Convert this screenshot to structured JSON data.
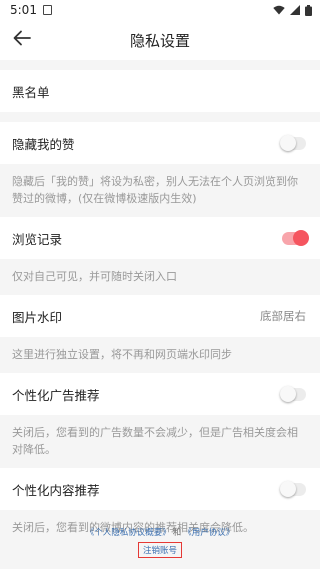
{
  "status_bar": {
    "time": "5:01",
    "icons": [
      "sim-icon",
      "wifi-icon",
      "signal-icon",
      "battery-icon"
    ]
  },
  "header": {
    "title": "隐私设置",
    "back_icon": "arrow-left-icon"
  },
  "settings": {
    "blacklist": {
      "label": "黑名单"
    },
    "hide_likes": {
      "label": "隐藏我的赞",
      "enabled": false,
      "desc": "隐藏后「我的赞」将设为私密，别人无法在个人页浏览到你赞过的微博，(仅在微博极速版内生效)"
    },
    "history": {
      "label": "浏览记录",
      "enabled": true,
      "desc": "仅对自己可见，并可随时关闭入口"
    },
    "watermark": {
      "label": "图片水印",
      "value": "底部居右",
      "desc": "这里进行独立设置，将不再和网页端水印同步"
    },
    "personalized_ads": {
      "label": "个性化广告推荐",
      "enabled": false,
      "desc": "关闭后，您看到的广告数量不会减少，但是广告相关度会相对降低。"
    },
    "personalized_content": {
      "label": "个性化内容推荐",
      "enabled": false,
      "desc": "关闭后，您看到的微博内容的推荐相关度会降低。"
    }
  },
  "footer": {
    "privacy_link": "《个人隐私协议概要》",
    "and_text": "和",
    "user_agreement_link": "《用户协议》",
    "cancel_account": "注销账号"
  },
  "colors": {
    "accent": "#f5555f",
    "link": "#3a6fb0",
    "highlight_border": "#e53935"
  }
}
